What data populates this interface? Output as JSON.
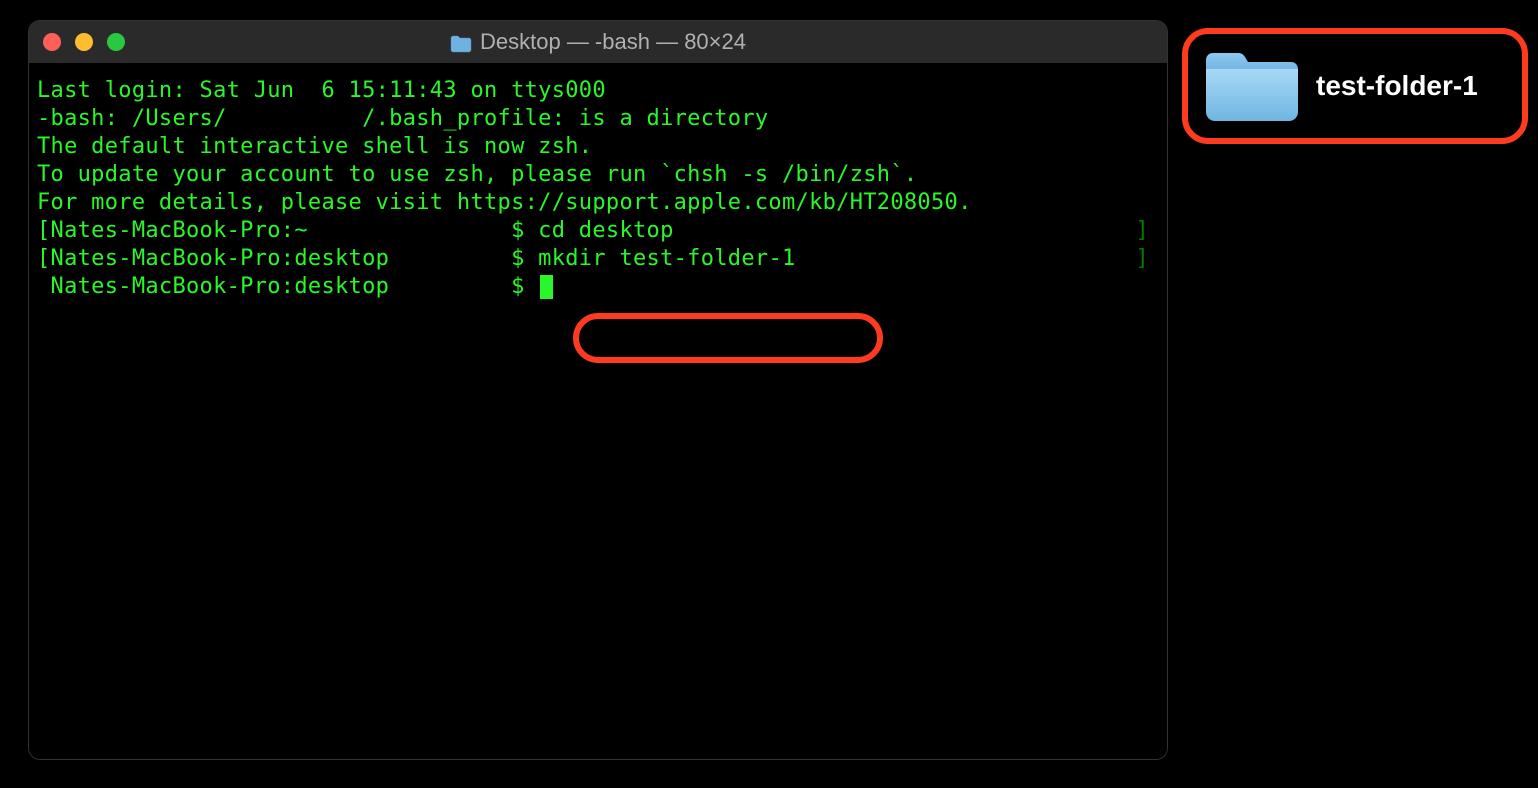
{
  "titlebar": {
    "title": "Desktop — -bash — 80×24"
  },
  "terminal": {
    "lines": [
      "Last login: Sat Jun  6 15:11:43 on ttys000",
      "-bash: /Users/          /.bash_profile: is a directory",
      "",
      "The default interactive shell is now zsh.",
      "To update your account to use zsh, please run `chsh -s /bin/zsh`.",
      "For more details, please visit https://support.apple.com/kb/HT208050."
    ],
    "prompt1": {
      "left": "[Nates-MacBook-Pro:~               $ ",
      "cmd": "cd desktop"
    },
    "prompt2": {
      "left": "[Nates-MacBook-Pro:desktop         $ ",
      "cmd": "mkdir test-folder-1"
    },
    "prompt3": {
      "left": " Nates-MacBook-Pro:desktop         $ "
    }
  },
  "desktop": {
    "folder_name": "test-folder-1"
  }
}
